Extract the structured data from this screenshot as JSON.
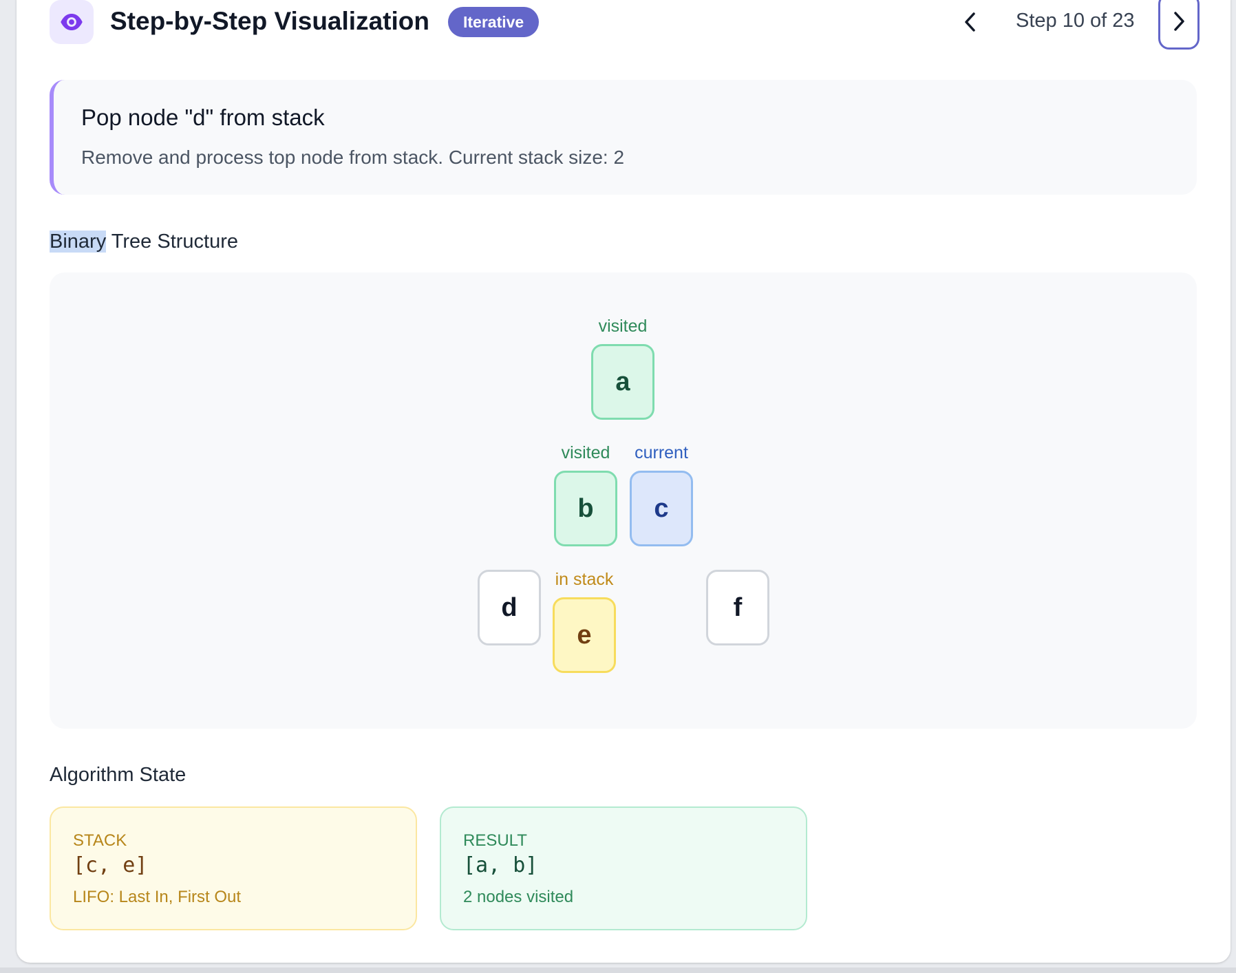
{
  "header": {
    "title": "Step-by-Step Visualization",
    "badge": "Iterative",
    "step_indicator": "Step 10 of 23",
    "icon": "eye-icon"
  },
  "step": {
    "title": "Pop node \"d\" from stack",
    "description": "Remove and process top node from stack. Current stack size: 2"
  },
  "tree_section": {
    "label_highlighted": "Binary",
    "label_rest": " Tree Structure"
  },
  "tree": {
    "nodes": [
      {
        "id": "a",
        "label": "a",
        "state": "visited",
        "status_text": "visited"
      },
      {
        "id": "b",
        "label": "b",
        "state": "visited",
        "status_text": "visited"
      },
      {
        "id": "c",
        "label": "c",
        "state": "current",
        "status_text": "current"
      },
      {
        "id": "d",
        "label": "d",
        "state": "default",
        "status_text": ""
      },
      {
        "id": "e",
        "label": "e",
        "state": "instack",
        "status_text": "in stack"
      },
      {
        "id": "f",
        "label": "f",
        "state": "default",
        "status_text": ""
      }
    ]
  },
  "algorithm_state": {
    "label": "Algorithm State",
    "stack": {
      "name": "STACK",
      "value": "[c, e]",
      "note": "LIFO: Last In, First Out"
    },
    "result": {
      "name": "RESULT",
      "value": "[a, b]",
      "note": "2 nodes visited"
    }
  },
  "colors": {
    "accent": "#6366c9",
    "visited": "#dcf7e9",
    "current": "#dde7fb",
    "in_stack": "#fef7c4"
  }
}
